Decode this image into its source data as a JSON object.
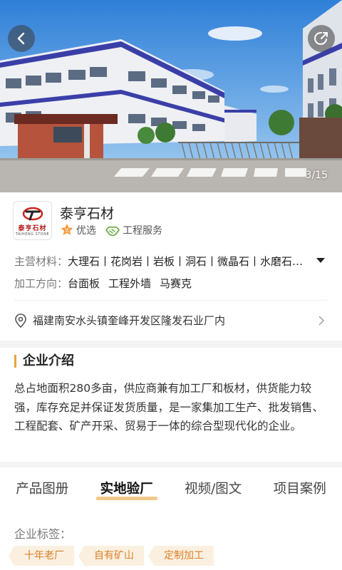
{
  "hero": {
    "counter": "3/15",
    "back_icon": "arrow-left-icon",
    "share_icon": "share-icon"
  },
  "company": {
    "logo_text": "泰亨石材",
    "logo_sub": "TAIHENG STONE",
    "name": "泰亨石材",
    "badges": [
      {
        "icon": "medal-icon",
        "label": "优选"
      },
      {
        "icon": "handshake-icon",
        "label": "工程服务"
      }
    ],
    "materials_label": "主营材料：",
    "materials": "大理石丨花岗岩丨岩板丨洞石丨微晶石丨水磨石…",
    "processing_label": "加工方向：",
    "processing": [
      "台面板",
      "工程外墙",
      "马赛克"
    ],
    "address": "福建南安水头镇奎峰开发区隆发石业厂内"
  },
  "intro": {
    "title": "企业介绍",
    "text": "总占地面积280多亩，供应商兼有加工厂和板材，供货能力较强，库存充足并保证发货质量，是一家集加工生产、批发销售、工程配套、矿产开采、贸易于一体的综合型现代化的企业。"
  },
  "tabs": {
    "items": [
      "产品图册",
      "实地验厂",
      "视频/图文",
      "项目案例"
    ],
    "active_index": 1
  },
  "tags_section": {
    "label": "企业标签：",
    "tags": [
      "十年老厂",
      "自有矿山",
      "定制加工"
    ]
  },
  "colors": {
    "accent": "#e8a53a",
    "tag_bg": "#fbf0e0",
    "tag_text": "#d9812a",
    "tab_underline": "#f0c98a"
  }
}
